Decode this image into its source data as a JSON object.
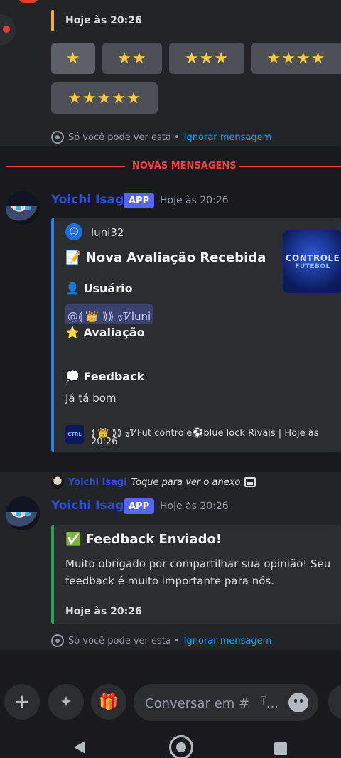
{
  "top_message": {
    "timestamp": "Hoje às 20:26",
    "rating_buttons": [
      "★",
      "★★",
      "★★★",
      "★★★★",
      "★★★★★"
    ],
    "ephemeral_note": "Só você pode ver esta •",
    "ephemeral_link": "Ignorar mensagem"
  },
  "divider": {
    "label": "NOVAS MENSAGENS"
  },
  "message1": {
    "username": "Yoichi Isagi",
    "badge": "APP",
    "time": "Hoje às 20:26",
    "embed": {
      "author": "luni32",
      "title": "📝 Nova Avaliação Recebida",
      "user_field_name": "👤 Usuário",
      "user_mention": "@⟬ 👑 ⟫⟫ ᢐᏤluni",
      "rating_field_name": "⭐ Avaliação",
      "feedback_field_name": "💭 Feedback",
      "feedback_value": "Já tá bom",
      "footer_line1": "⟬ 👑 ⟫⟫ ᢐᏤFut controle⚽blue lock Rivais | Hoje às",
      "footer_line2": "20:26",
      "thumbnail_title": "CONTROLE",
      "thumbnail_sub": "FUTEBOL",
      "accent_color": "#2b7de9"
    }
  },
  "message2": {
    "reply_user": "Yoichi Isagi",
    "reply_text": "Toque para ver o anexo",
    "username": "Yoichi Isagi",
    "badge": "APP",
    "time": "Hoje às 20:26",
    "embed": {
      "title": "✅ Feedback Enviado!",
      "description_line1": "Muito obrigado por compartilhar sua opinião! Seu",
      "description_line2": "feedback é muito importante para nós.",
      "footer": "Hoje às 20:26",
      "accent_color": "#23a55a"
    },
    "ephemeral_note": "Só você pode ver esta •",
    "ephemeral_link": "Ignorar mensagem"
  },
  "composer": {
    "placeholder": "Conversar em # 『...",
    "plus_icon": "+",
    "apps_icon": "apps-icon",
    "gift_icon": "gift-icon"
  }
}
